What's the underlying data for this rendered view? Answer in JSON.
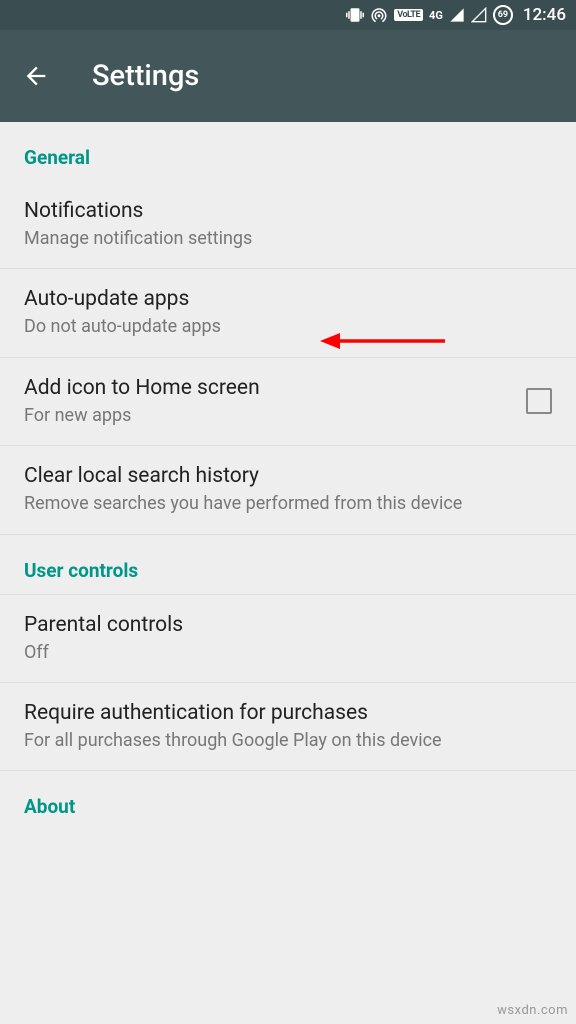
{
  "statusBar": {
    "volte": "VoLTE",
    "network": "4G",
    "battery": "69",
    "time": "12:46"
  },
  "appBar": {
    "title": "Settings"
  },
  "sections": {
    "general": {
      "header": "General",
      "notifications": {
        "title": "Notifications",
        "subtitle": "Manage notification settings"
      },
      "autoUpdate": {
        "title": "Auto-update apps",
        "subtitle": "Do not auto-update apps"
      },
      "addIcon": {
        "title": "Add icon to Home screen",
        "subtitle": "For new apps"
      },
      "clearSearch": {
        "title": "Clear local search history",
        "subtitle": "Remove searches you have performed from this device"
      }
    },
    "userControls": {
      "header": "User controls",
      "parental": {
        "title": "Parental controls",
        "subtitle": "Off"
      },
      "auth": {
        "title": "Require authentication for purchases",
        "subtitle": "For all purchases through Google Play on this device"
      }
    },
    "about": {
      "header": "About"
    }
  },
  "watermark": "wsxdn.com"
}
